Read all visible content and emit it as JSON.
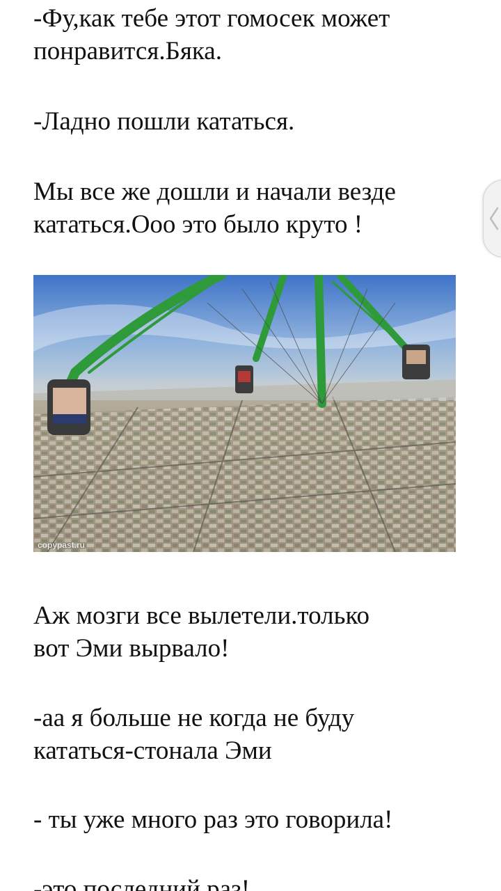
{
  "paragraphs": {
    "p1": [
      "-Фу,как тебе этот гомосек может",
      "понравится.Бяка."
    ],
    "p2": [
      "-Ладно пошли кататься."
    ],
    "p3": [
      "Мы все же дошли и начали везде",
      "кататься.Ооо это было круто !"
    ],
    "p4": [
      "Аж мозги все вылетели.только",
      "вот Эми вырвало!"
    ],
    "p5": [
      "-аа я больше не когда не буду",
      "кататься-стонала Эми"
    ],
    "p6": [
      "- ты уже много раз это говорила!"
    ],
    "p7": [
      "-это последний раз!"
    ]
  },
  "image": {
    "watermark": "copypast.ru",
    "description_icon": "amusement-ride-photo"
  },
  "side_handle": {
    "icon": "chevron-left-icon"
  },
  "colors": {
    "text": "#111111",
    "background": "#ffffff",
    "ride_green": "#2e9a3a"
  }
}
